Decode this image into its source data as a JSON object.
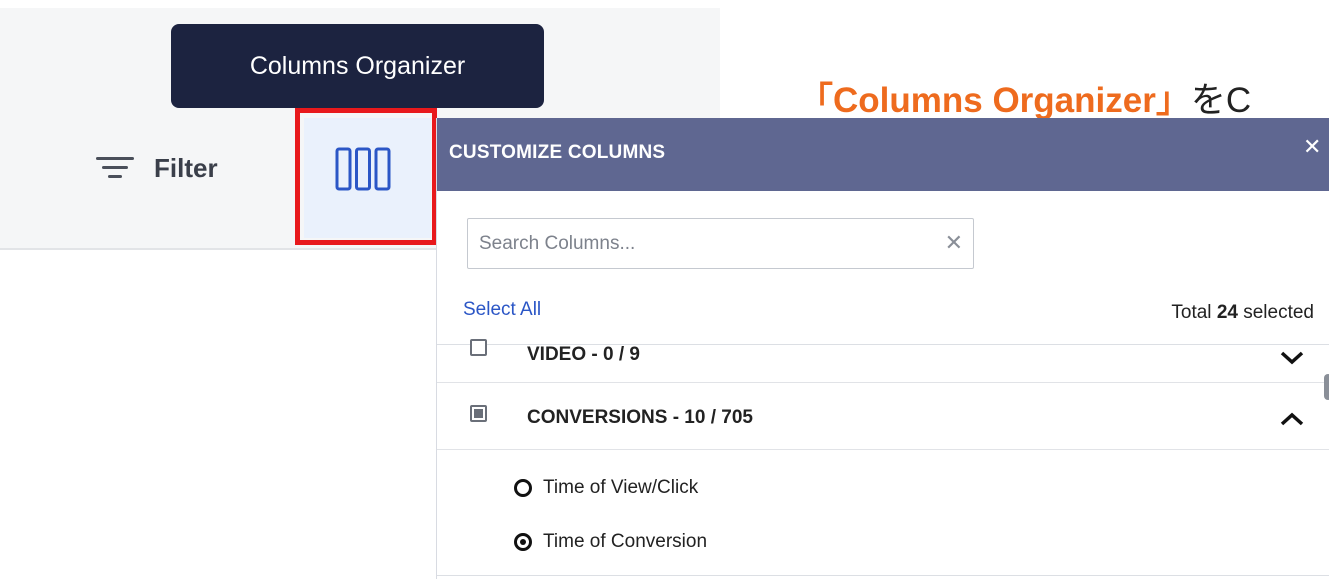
{
  "tooltip": {
    "text": "Columns Organizer"
  },
  "toolbar": {
    "filter_label": "Filter",
    "filter_icon": "filter-lines-icon",
    "columns_icon": "columns-icon"
  },
  "annotation": {
    "highlight": "「Columns Organizer」",
    "tail": "をC"
  },
  "panel": {
    "title": "CUSTOMIZE COLUMNS",
    "close_icon": "close-icon",
    "search": {
      "placeholder": "Search Columns...",
      "value": ""
    },
    "select_all_label": "Select All",
    "total_prefix": "Total ",
    "total_count": "24",
    "total_suffix": " selected",
    "groups": [
      {
        "label": "VIDEO - 0 / 9",
        "checkbox": "unchecked",
        "expanded": false
      },
      {
        "label": "CONVERSIONS - 10 / 705",
        "checkbox": "partial",
        "expanded": true
      }
    ],
    "options": [
      {
        "label": "Time of View/Click",
        "selected": false
      },
      {
        "label": "Time of Conversion",
        "selected": true
      }
    ]
  },
  "colors": {
    "tooltip_bg": "#1c2340",
    "panel_header": "#5f6791",
    "highlight_red": "#e8191c",
    "annotation_orange": "#ee6b1e",
    "link_blue": "#2b56c6"
  }
}
